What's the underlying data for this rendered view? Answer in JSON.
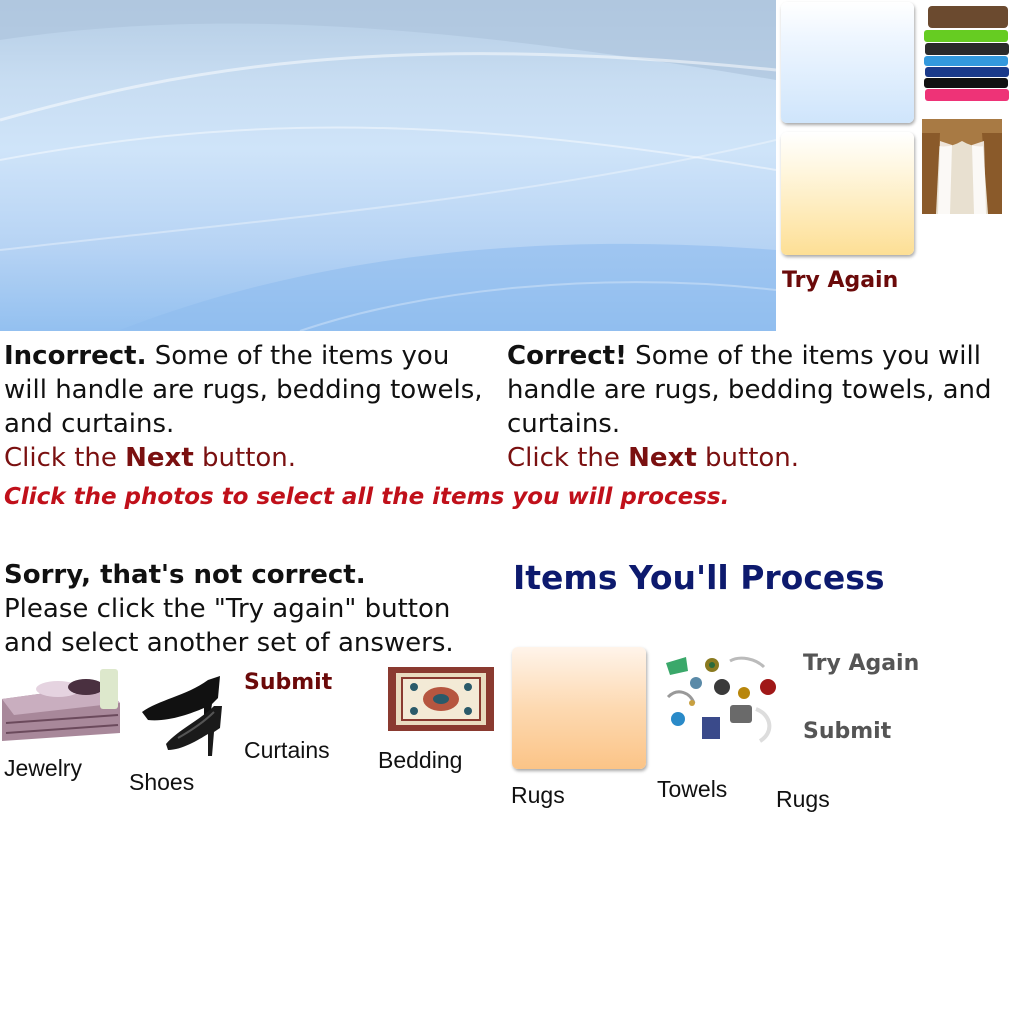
{
  "top_right": {
    "try_again_label": "Try Again"
  },
  "feedback": {
    "incorrect": {
      "status": "Incorrect.",
      "message": " Some of the items you will handle are rugs, bedding towels, and curtains.",
      "next_pre": "Click the ",
      "next_word": "Next",
      "next_post": " button."
    },
    "correct": {
      "status": "Correct!",
      "message": " Some of the items you will handle are rugs, bedding towels, and curtains.",
      "next_pre": "Click the ",
      "next_word": "Next",
      "next_post": " button."
    }
  },
  "instruction": "Click the photos to select all the items you will process.",
  "sorry": {
    "title": "Sorry, that's not correct.",
    "message": "Please click the \"Try again\" button and select another set of answers."
  },
  "heading": "Items You'll Process",
  "left_items": {
    "submit_label": "Submit",
    "captions": {
      "jewelry": "Jewelry",
      "shoes": "Shoes",
      "curtains": "Curtains",
      "bedding": "Bedding"
    }
  },
  "right_items": {
    "try_again_label": "Try Again",
    "submit_label": "Submit",
    "captions": {
      "rugs_1": "Rugs",
      "towels": "Towels",
      "rugs_2": "Rugs"
    }
  },
  "colors": {
    "dark_red": "#6b0a0a",
    "instruction_red": "#c0101a",
    "heading_navy": "#0d1a6e",
    "gray_label": "#555555"
  }
}
